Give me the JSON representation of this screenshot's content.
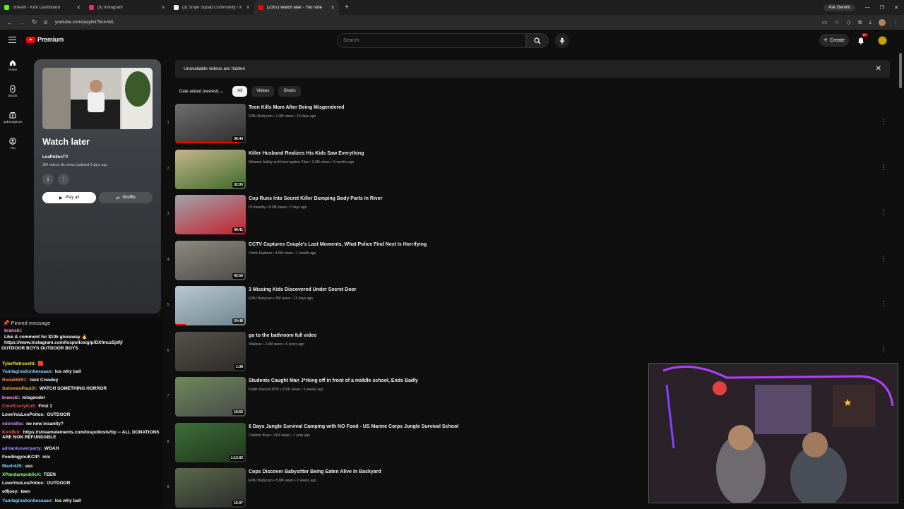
{
  "browser": {
    "tabs": [
      {
        "title": "Stream - Kick Dashboard",
        "color": "#53fc18"
      },
      {
        "title": "(9) Instagram",
        "color": "#e1306c"
      },
      {
        "title": "(3) Snipe Squad Community / X",
        "color": "#ffffff"
      },
      {
        "title": "(2167) Watch later - YouTube",
        "color": "#ff0000"
      }
    ],
    "active_tab": 3,
    "gemini_label": "Ask Gemini",
    "url": "youtube.com/playlist?list=WL"
  },
  "masthead": {
    "logo_text": "Premium",
    "search_placeholder": "Search",
    "create_label": "Create",
    "notification_count": "9+"
  },
  "sidenav": [
    {
      "label": "Home",
      "icon": "home-icon"
    },
    {
      "label": "Shorts",
      "icon": "shorts-icon"
    },
    {
      "label": "Subscriptions",
      "icon": "subscriptions-icon"
    },
    {
      "label": "You",
      "icon": "you-icon"
    }
  ],
  "playlist": {
    "title": "Watch later",
    "owner": "LosPollosTV",
    "meta": "354 videos  No views  Updated 3 days ago",
    "play_all_label": "Play all",
    "shuffle_label": "Shuffle"
  },
  "banner": {
    "text": "Unavailable videos are hidden"
  },
  "filters": {
    "sort_label": "Date added (newest)",
    "chips": [
      "All",
      "Videos",
      "Shorts"
    ],
    "active_chip": 0
  },
  "videos": [
    {
      "num": "1",
      "title": "Teen Kills Mom After Being Misgendered",
      "channel": "EWU Bodycam",
      "views": "2.4M views",
      "age": "10 days ago",
      "duration": "36:44",
      "progress": 0.9,
      "thumb": [
        "#6e6e6e",
        "#2e2e2e"
      ]
    },
    {
      "num": "2",
      "title": "Killer Husband Realizes His Kids Saw Everything",
      "channel": "Midwest Safety and Interrogation Files",
      "views": "3.3M views",
      "age": "2 months ago",
      "duration": "32:05",
      "progress": 0,
      "thumb": [
        "#c7b58a",
        "#3f6b2c"
      ]
    },
    {
      "num": "3",
      "title": "Cop Runs Into Secret Killer Dumping Body Parts In River",
      "channel": "Dr Insanity",
      "views": "8.2M views",
      "age": "7 days ago",
      "duration": "40:41",
      "progress": 0,
      "thumb": [
        "#9ea5ab",
        "#c72030"
      ]
    },
    {
      "num": "4",
      "title": "CCTV Captures Couple's Last Moments, What Police Find Next Is Horrifying",
      "channel": "Crime Explorer",
      "views": "4.5M views",
      "age": "1 month ago",
      "duration": "43:50",
      "progress": 0,
      "thumb": [
        "#8d8a80",
        "#4d4c47"
      ]
    },
    {
      "num": "5",
      "title": "3 Missing Kids Discovered Under Secret Door",
      "channel": "EWU Bodycam",
      "views": "5M views",
      "age": "12 days ago",
      "duration": "24:48",
      "progress": 0.15,
      "thumb": [
        "#b7c8cf",
        "#6f8690"
      ]
    },
    {
      "num": "6",
      "title": "go to the bathroom full video",
      "channel": "Vitalicus",
      "views": "2.3M views",
      "age": "6 years ago",
      "duration": "1:38",
      "progress": 0,
      "thumb": [
        "#55524c",
        "#2e2c29"
      ]
    },
    {
      "num": "7",
      "title": "Students Caught Man J*rking off in front of a middle school, Ends Badly",
      "channel": "Public Record POV",
      "views": "570K views",
      "age": "3 weeks ago",
      "duration": "18:52",
      "progress": 0,
      "thumb": [
        "#6b8a5a",
        "#4a4a4a"
      ]
    },
    {
      "num": "8",
      "title": "6 Days Jungle Survival Camping with NO Food - US Marine Corps Jungle Survival School",
      "channel": "Outdoor Boys",
      "views": "31M views",
      "age": "1 year ago",
      "duration": "1:13:02",
      "progress": 0,
      "thumb": [
        "#3e6e3a",
        "#20361c"
      ]
    },
    {
      "num": "9",
      "title": "Cops Discover Babysitter Being Eaten Alive in Backyard",
      "channel": "EWU Bodycam",
      "views": "5.6M views",
      "age": "2 weeks ago",
      "duration": "15:07",
      "progress": 0,
      "thumb": [
        "#5b6a4a",
        "#2b2b2b"
      ]
    }
  ],
  "chat": {
    "pinned_label": "Pinned message",
    "pinned_user": "branski:",
    "pinned_lines": [
      "Like & comment for $10k giveaway 🔥",
      "https://www.instagram.com/lospollosig/p/DXfmuz5jdfj/",
      "OUTDOOR BOYS OUTDOOR BOYS"
    ],
    "messages": [
      {
        "user": "TylerRetrovetti:",
        "text": "🟥",
        "color": "#f7e15b"
      },
      {
        "user": "Yamlaginallonbeeaaan:",
        "text": "los why ball",
        "color": "#7cd6ff"
      },
      {
        "user": "Reda66691:",
        "text": "nick Crowley",
        "color": "#ff7f50"
      },
      {
        "user": "SolomonPaulJr:",
        "text": "WATCH SOMETHING HORROR",
        "color": "#f7b733"
      },
      {
        "user": "branski:",
        "text": "misgender",
        "color": "#ff9de0"
      },
      {
        "user": "ChiefCurryCult:",
        "text": "First 1",
        "color": "#ff4d4d"
      },
      {
        "user": "LoveYouLosPollos:",
        "text": "OUTDOOR",
        "color": "#ffffff"
      },
      {
        "user": "edonaths:",
        "text": "no new insanity?",
        "color": "#c98cff"
      },
      {
        "user": "KickBot:",
        "text": "https://streamelements.com/lospollostv/tip -- ALL DONATIONS ARE NON REFUNDABLE",
        "color": "#ff4d4d"
      },
      {
        "user": "adrianisoverparty:",
        "text": "WOAH",
        "color": "#b28cff"
      },
      {
        "user": "FeedingyouKCIP:",
        "text": "mis",
        "color": "#ffffff"
      },
      {
        "user": "Maxh425:",
        "text": "ass",
        "color": "#7cd6ff"
      },
      {
        "user": "XPandarepublicX:",
        "text": "TEEN",
        "color": "#8cff8c"
      },
      {
        "user": "LoveYouLosPollos:",
        "text": "OUTDOOR",
        "color": "#ffffff"
      },
      {
        "user": "offjoey:",
        "text": "teen",
        "color": "#ffffff"
      },
      {
        "user": "Yamlaginallonbeeaaan:",
        "text": "los why ball",
        "color": "#7cd6ff"
      }
    ]
  }
}
